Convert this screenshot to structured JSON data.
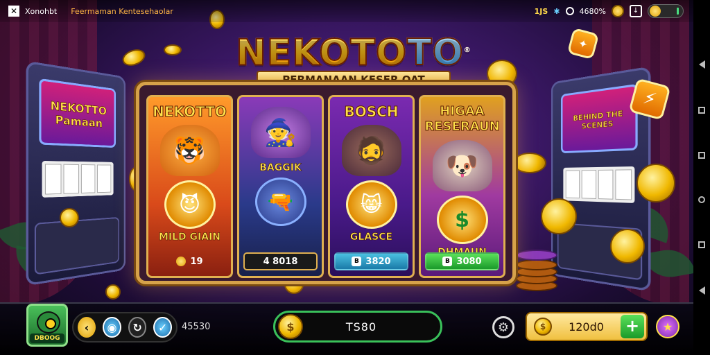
{
  "topbar": {
    "app_name": "Xonohbt",
    "tagline": "Feermaman Kentesehaolar",
    "stat_left": "1JS",
    "stat_pct": "4680%",
    "toggle_icon": "gold-coin-toggle"
  },
  "logo": {
    "title_a": "NEKOTO",
    "title_b": "TO",
    "subtitle": "PERMANAAN KESER OAT",
    "registered": "®"
  },
  "cards": [
    {
      "title": "NEKOTTO",
      "mid": "",
      "label": "MILD GIAIN",
      "price": "19",
      "price_icon": "coin-icon",
      "emoji": "🐯",
      "medal": "😈"
    },
    {
      "title": "",
      "mid": "BAGGIK",
      "label": "",
      "price": "4 8018",
      "price_icon": "",
      "emoji": "🧙",
      "medal": "🔫"
    },
    {
      "title": "BOSCH",
      "mid": "",
      "label": "GLASCE",
      "price": "3820",
      "price_icon": "B",
      "emoji": "🧔",
      "medal": "😸"
    },
    {
      "title": "HIGAA RESERAUN",
      "mid": "",
      "label": "DHMAUN",
      "price": "3080",
      "price_icon": "B",
      "emoji": "🐶",
      "medal": "$"
    }
  ],
  "slots": {
    "left_screen": "NEKOTTO Pamaan",
    "right_screen": "BEHIND THE SCENES"
  },
  "bottombar": {
    "avatar_label": "DBOOG",
    "count": "45530",
    "center_value": "TS80",
    "balance": "120d0",
    "plus": "+"
  },
  "colors": {
    "gold": "#f0b800",
    "frame": "#d6a24a",
    "accent_green": "#3ac05a"
  }
}
